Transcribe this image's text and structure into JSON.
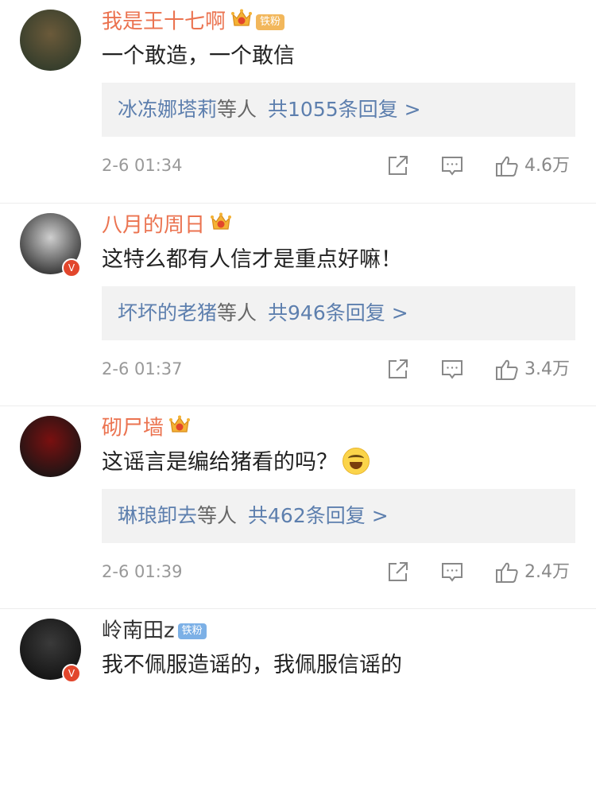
{
  "comments": [
    {
      "user": "我是王十七啊",
      "vip": true,
      "fan_badge": "铁粉",
      "fan_badge_color": "#f2b75b",
      "verified": false,
      "text": "一个敢造，一个敢信",
      "emoji": null,
      "reply_names": "冰冻娜塔莉",
      "reply_suffix": "等人",
      "reply_count": "共1055条回复 >",
      "time": "2-6 01:34",
      "likes": "4.6万",
      "avatar_colors": [
        "#6b5a3a",
        "#2f3a2a"
      ]
    },
    {
      "user": "八月的周日",
      "vip": true,
      "fan_badge": null,
      "verified": true,
      "text": "这特么都有人信才是重点好嘛！",
      "emoji": null,
      "reply_names": "坏坏的老猪",
      "reply_suffix": "等人",
      "reply_count": "共946条回复 >",
      "time": "2-6 01:37",
      "likes": "3.4万",
      "avatar_colors": [
        "#cfcfcf",
        "#2a2a2a"
      ]
    },
    {
      "user": "砌尸墙",
      "vip": true,
      "fan_badge": null,
      "verified": false,
      "text": "这谣言是编给猪看的吗？",
      "emoji": "laugh-cry-emoji",
      "reply_names": "琳琅卸去",
      "reply_suffix": "等人",
      "reply_count": "共462条回复 >",
      "time": "2-6 01:39",
      "likes": "2.4万",
      "avatar_colors": [
        "#7a1010",
        "#151515"
      ]
    },
    {
      "user": "岭南田z",
      "vip": false,
      "fan_badge": "铁粉",
      "fan_badge_color": "#7cb0e6",
      "verified": true,
      "text": "我不佩服造谣的，我佩服信谣的",
      "emoji": null,
      "reply_names": null,
      "reply_suffix": null,
      "reply_count": null,
      "time": null,
      "likes": null,
      "avatar_colors": [
        "#3a3a3a",
        "#111111"
      ]
    }
  ],
  "colors": {
    "vip_name": "#eb7350",
    "link_blue": "#5d7fae",
    "meta_gray": "#999999",
    "reply_bg": "#f2f2f2",
    "verified_red": "#e2462c"
  },
  "icons": {
    "vip": "crown-icon",
    "verified": "verified-v-icon",
    "share": "share-icon",
    "comment": "comment-icon",
    "like": "thumbs-up-icon"
  }
}
